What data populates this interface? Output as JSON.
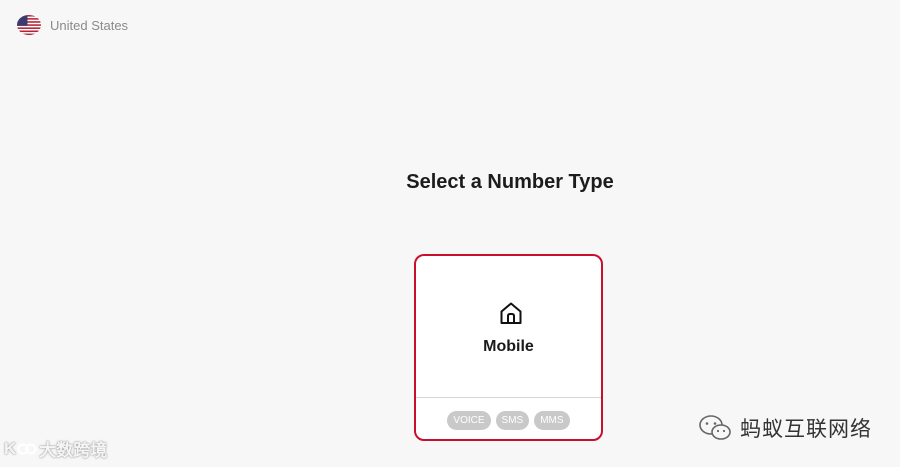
{
  "country": {
    "label": "United States",
    "flag_icon": "us-flag-icon"
  },
  "page": {
    "title": "Select a Number Type"
  },
  "card": {
    "icon": "home-icon",
    "label": "Mobile",
    "tags": [
      "VOICE",
      "SMS",
      "MMS"
    ],
    "border_color": "#c8102e"
  },
  "watermark_left": {
    "logo": "K",
    "text": "大数跨境"
  },
  "watermark_right": {
    "icon": "wechat-icon",
    "text": "蚂蚁互联网络"
  }
}
